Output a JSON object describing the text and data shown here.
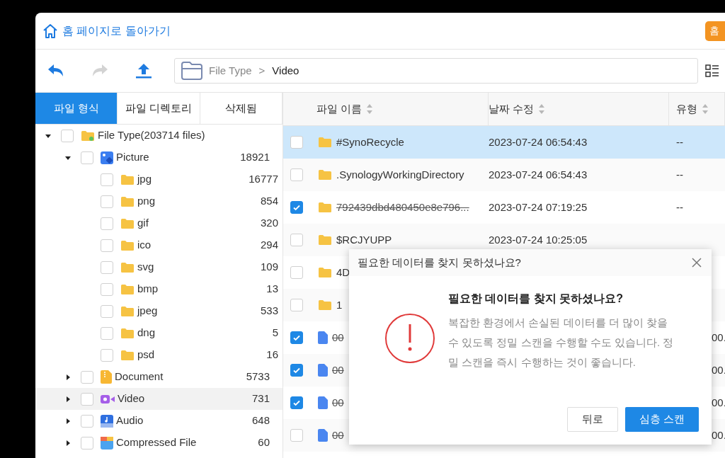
{
  "header": {
    "home_link": "홈 페이지로 돌아가기",
    "corner_button": "홈"
  },
  "toolbar": {
    "back": {
      "disabled": false
    },
    "forward": {
      "disabled": true
    },
    "path": [
      "File Type",
      "Video"
    ],
    "separator": ">"
  },
  "tabs": [
    {
      "label": "파일 형식",
      "selected": true
    },
    {
      "label": "파일 디렉토리",
      "selected": false
    },
    {
      "label": "삭제됨",
      "selected": false
    }
  ],
  "tree": [
    {
      "label": "File Type(203714 files)",
      "kind": "root",
      "expanded": true,
      "checked": false,
      "selected": false,
      "children": [
        {
          "label": "Picture",
          "count": "18921",
          "kind": "picture",
          "expanded": true,
          "checked": false,
          "selected": false,
          "children": [
            {
              "label": "jpg",
              "count": "16777",
              "kind": "folder",
              "checked": false,
              "selected": false
            },
            {
              "label": "png",
              "count": "854",
              "kind": "folder",
              "checked": false,
              "selected": false
            },
            {
              "label": "gif",
              "count": "320",
              "kind": "folder",
              "checked": false,
              "selected": false
            },
            {
              "label": "ico",
              "count": "294",
              "kind": "folder",
              "checked": false,
              "selected": false
            },
            {
              "label": "svg",
              "count": "109",
              "kind": "folder",
              "checked": false,
              "selected": false
            },
            {
              "label": "bmp",
              "count": "13",
              "kind": "folder",
              "checked": false,
              "selected": false
            },
            {
              "label": "jpeg",
              "count": "533",
              "kind": "folder",
              "checked": false,
              "selected": false
            },
            {
              "label": "dng",
              "count": "5",
              "kind": "folder",
              "checked": false,
              "selected": false
            },
            {
              "label": "psd",
              "count": "16",
              "kind": "folder",
              "checked": false,
              "selected": false
            }
          ]
        },
        {
          "label": "Document",
          "count": "5733",
          "kind": "document",
          "expanded": false,
          "checked": false,
          "selected": false
        },
        {
          "label": "Video",
          "count": "731",
          "kind": "video",
          "expanded": false,
          "checked": false,
          "selected": true
        },
        {
          "label": "Audio",
          "count": "648",
          "kind": "audio",
          "expanded": false,
          "checked": false,
          "selected": false
        },
        {
          "label": "Compressed File",
          "count": "60",
          "kind": "archive",
          "expanded": false,
          "checked": false,
          "selected": false
        }
      ]
    }
  ],
  "table": {
    "columns": [
      "파일 이름",
      "날짜 수정",
      "유형"
    ],
    "rows": [
      {
        "name": "#SynoRecycle",
        "modified": "2023-07-24 06:54:43",
        "type": "--",
        "kind": "folder",
        "checked": false,
        "selected": true,
        "deleted": false
      },
      {
        "name": ".SynologyWorkingDirectory",
        "modified": "2023-07-24 06:54:43",
        "type": "--",
        "kind": "folder",
        "checked": false,
        "selected": false,
        "deleted": false
      },
      {
        "name": "792439dbd480450e8e796...",
        "modified": "2023-07-24 07:19:25",
        "type": "--",
        "kind": "folder",
        "checked": true,
        "selected": false,
        "deleted": true
      },
      {
        "name": "$RCJYUPP",
        "modified": "2023-07-24 10:25:05",
        "kind": "folder",
        "checked": false,
        "selected": false,
        "deleted": false
      },
      {
        "name": "4D",
        "kind": "folder",
        "checked": false,
        "selected": false,
        "deleted": false
      },
      {
        "name": "1",
        "kind": "folder",
        "checked": false,
        "selected": false,
        "deleted": false
      },
      {
        "name": "00",
        "type": "00.",
        "kind": "file",
        "checked": true,
        "selected": false,
        "deleted": true
      },
      {
        "name": "00",
        "type": "00.",
        "kind": "file",
        "checked": true,
        "selected": false,
        "deleted": true
      },
      {
        "name": "00",
        "type": "00.",
        "kind": "file",
        "checked": true,
        "selected": false,
        "deleted": true
      },
      {
        "name": "00",
        "type": "00.",
        "kind": "file",
        "checked": false,
        "selected": false,
        "deleted": true
      }
    ]
  },
  "dialog": {
    "title": "필요한 데이터를 찾지 못하셨나요?",
    "heading": "필요한 데이터를 찾지 못하셨나요?",
    "message": "복잡한 환경에서 손실된 데이터를 더 많이 찾을 수 있도록 정밀 스캔을 수행할 수도 있습니다. 정밀 스캔을 즉시 수행하는 것이 좋습니다.",
    "buttons": [
      {
        "label": "뒤로",
        "primary": false
      },
      {
        "label": "심층 스캔",
        "primary": true
      }
    ]
  }
}
